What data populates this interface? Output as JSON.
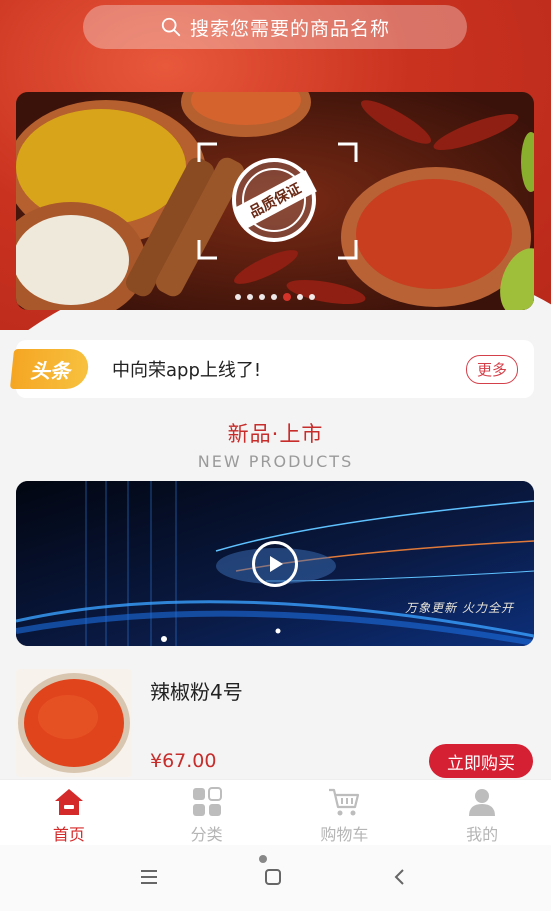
{
  "search": {
    "placeholder": "搜索您需要的商品名称",
    "icon": "search-icon"
  },
  "banner": {
    "stamp_text": "品质保证",
    "slide_count": 7,
    "active_slide": 5
  },
  "headline": {
    "badge": "头条",
    "text": "中向荣app上线了!",
    "more_label": "更多"
  },
  "new_products": {
    "title_cn": "新品·上市",
    "title_en": "NEW PRODUCTS"
  },
  "video": {
    "caption": "万象更新 火力全开"
  },
  "product": {
    "name": "辣椒粉4号",
    "price": "¥67.00",
    "buy_label": "立即购买"
  },
  "tabbar": {
    "items": [
      {
        "label": "首页",
        "icon": "home-icon",
        "active": true
      },
      {
        "label": "分类",
        "icon": "category-icon",
        "active": false
      },
      {
        "label": "购物车",
        "icon": "cart-icon",
        "active": false
      },
      {
        "label": "我的",
        "icon": "user-icon",
        "active": false
      }
    ]
  },
  "colors": {
    "brand_red": "#d51f32",
    "accent_orange": "#f5a623",
    "inactive_gray": "#b5b5b5"
  }
}
